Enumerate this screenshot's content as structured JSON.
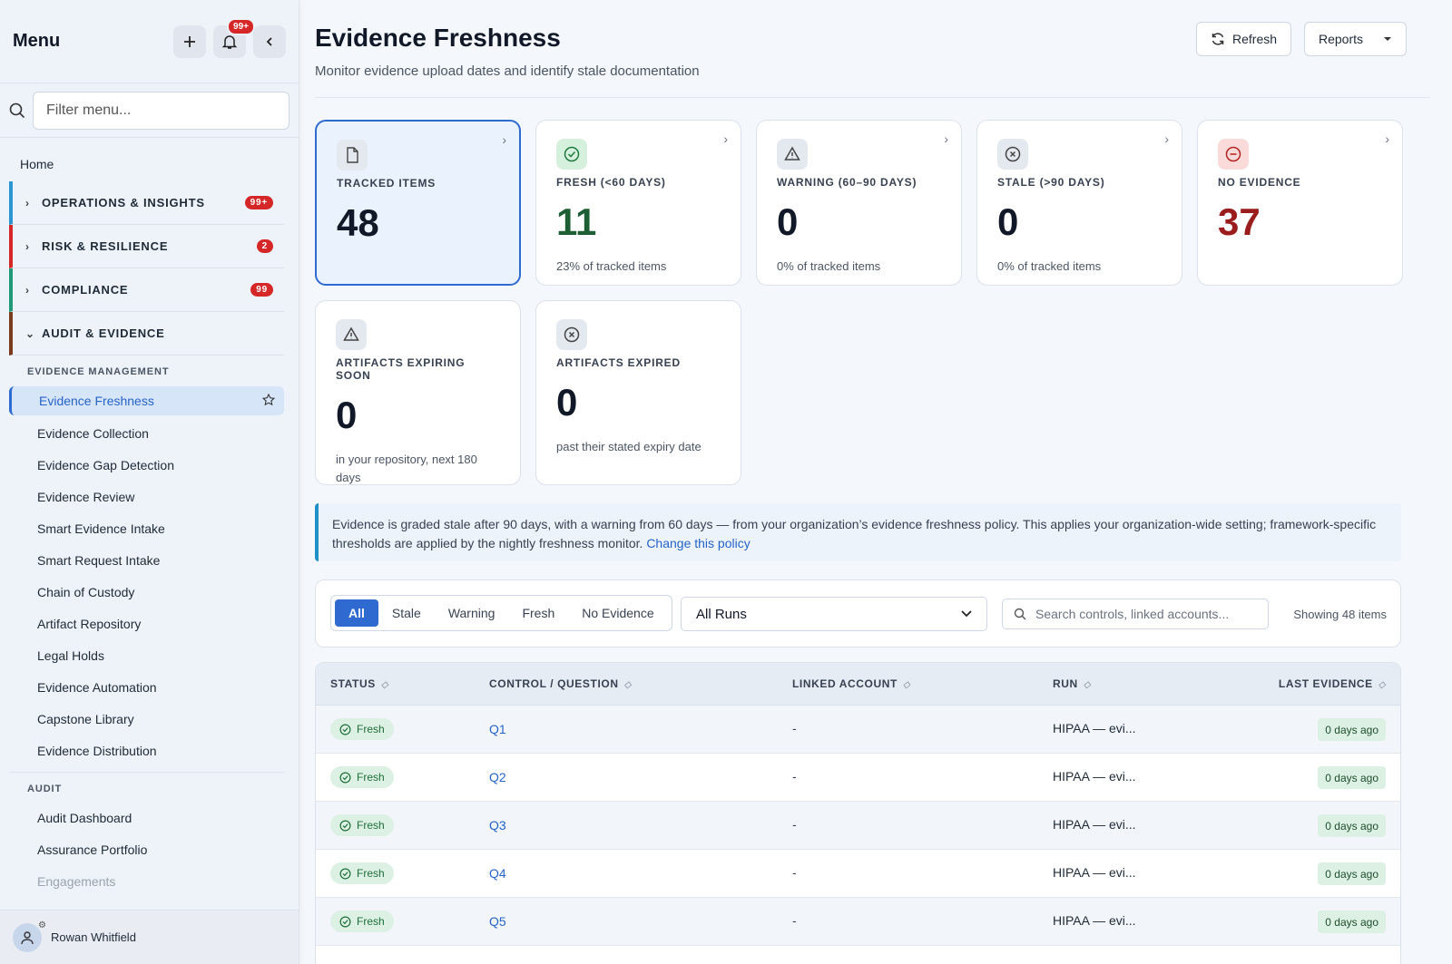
{
  "sidebar": {
    "title": "Menu",
    "notif_count": "99+",
    "filter_placeholder": "Filter menu...",
    "home": "Home",
    "groups": [
      {
        "label": "OPERATIONS & INSIGHTS",
        "badge": "99+",
        "color": "#2a95d0"
      },
      {
        "label": "RISK & RESILIENCE",
        "badge": "2",
        "color": "#d52727"
      },
      {
        "label": "COMPLIANCE",
        "badge": "99",
        "color": "#1f9a76"
      },
      {
        "label": "AUDIT & EVIDENCE",
        "badge": "",
        "color": "#7a3a1e"
      }
    ],
    "section_evidence": "EVIDENCE MANAGEMENT",
    "evidence_items": [
      "Evidence Freshness",
      "Evidence Collection",
      "Evidence Gap Detection",
      "Evidence Review",
      "Smart Evidence Intake",
      "Smart Request Intake",
      "Chain of Custody",
      "Artifact Repository",
      "Legal Holds",
      "Evidence Automation",
      "Capstone Library",
      "Evidence Distribution"
    ],
    "section_audit": "AUDIT",
    "audit_items": [
      "Audit Dashboard",
      "Assurance Portfolio",
      "Engagements"
    ],
    "user": "Rowan Whitfield"
  },
  "header": {
    "title": "Evidence Freshness",
    "subtitle": "Monitor evidence upload dates and identify stale documentation",
    "refresh": "Refresh",
    "reports": "Reports"
  },
  "cards": [
    {
      "label": "TRACKED ITEMS",
      "value": "48",
      "sub": "",
      "color": "#111827",
      "icon": "document-icon"
    },
    {
      "label": "FRESH (<60 DAYS)",
      "value": "11",
      "sub": "23% of tracked items",
      "color": "#1e5e34",
      "icon": "check-circle-icon"
    },
    {
      "label": "WARNING (60–90 DAYS)",
      "value": "0",
      "sub": "0% of tracked items",
      "color": "#111827",
      "icon": "warning-icon"
    },
    {
      "label": "STALE (>90 DAYS)",
      "value": "0",
      "sub": "0% of tracked items",
      "color": "#111827",
      "icon": "x-circle-icon"
    },
    {
      "label": "NO EVIDENCE",
      "value": "37",
      "sub": "",
      "color": "#9b1c1c",
      "icon": "minus-circle-icon"
    },
    {
      "label": "ARTIFACTS EXPIRING SOON",
      "value": "0",
      "sub": "in your repository, next 180 days",
      "color": "#111827",
      "icon": "warning-icon"
    },
    {
      "label": "ARTIFACTS EXPIRED",
      "value": "0",
      "sub": "past their stated expiry date",
      "color": "#111827",
      "icon": "x-circle-icon"
    }
  ],
  "banner": {
    "text": "Evidence is graded stale after 90 days, with a warning from 60 days — from your organization’s evidence freshness policy. This applies your organization-wide setting; framework-specific thresholds are applied by the nightly freshness monitor. ",
    "link": "Change this policy"
  },
  "filters": {
    "tabs": [
      "All",
      "Stale",
      "Warning",
      "Fresh",
      "No Evidence"
    ],
    "run_select": "All Runs",
    "search_placeholder": "Search controls, linked accounts...",
    "count": "Showing 48 items"
  },
  "table": {
    "columns": [
      "STATUS",
      "CONTROL / QUESTION",
      "LINKED ACCOUNT",
      "RUN",
      "LAST EVIDENCE"
    ],
    "rows": [
      {
        "status": "Fresh",
        "control": "Q1",
        "account": "-",
        "run": "HIPAA — evi...",
        "last": "0 days ago"
      },
      {
        "status": "Fresh",
        "control": "Q2",
        "account": "-",
        "run": "HIPAA — evi...",
        "last": "0 days ago"
      },
      {
        "status": "Fresh",
        "control": "Q3",
        "account": "-",
        "run": "HIPAA — evi...",
        "last": "0 days ago"
      },
      {
        "status": "Fresh",
        "control": "Q4",
        "account": "-",
        "run": "HIPAA — evi...",
        "last": "0 days ago"
      },
      {
        "status": "Fresh",
        "control": "Q5",
        "account": "-",
        "run": "HIPAA — evi...",
        "last": "0 days ago"
      }
    ]
  }
}
